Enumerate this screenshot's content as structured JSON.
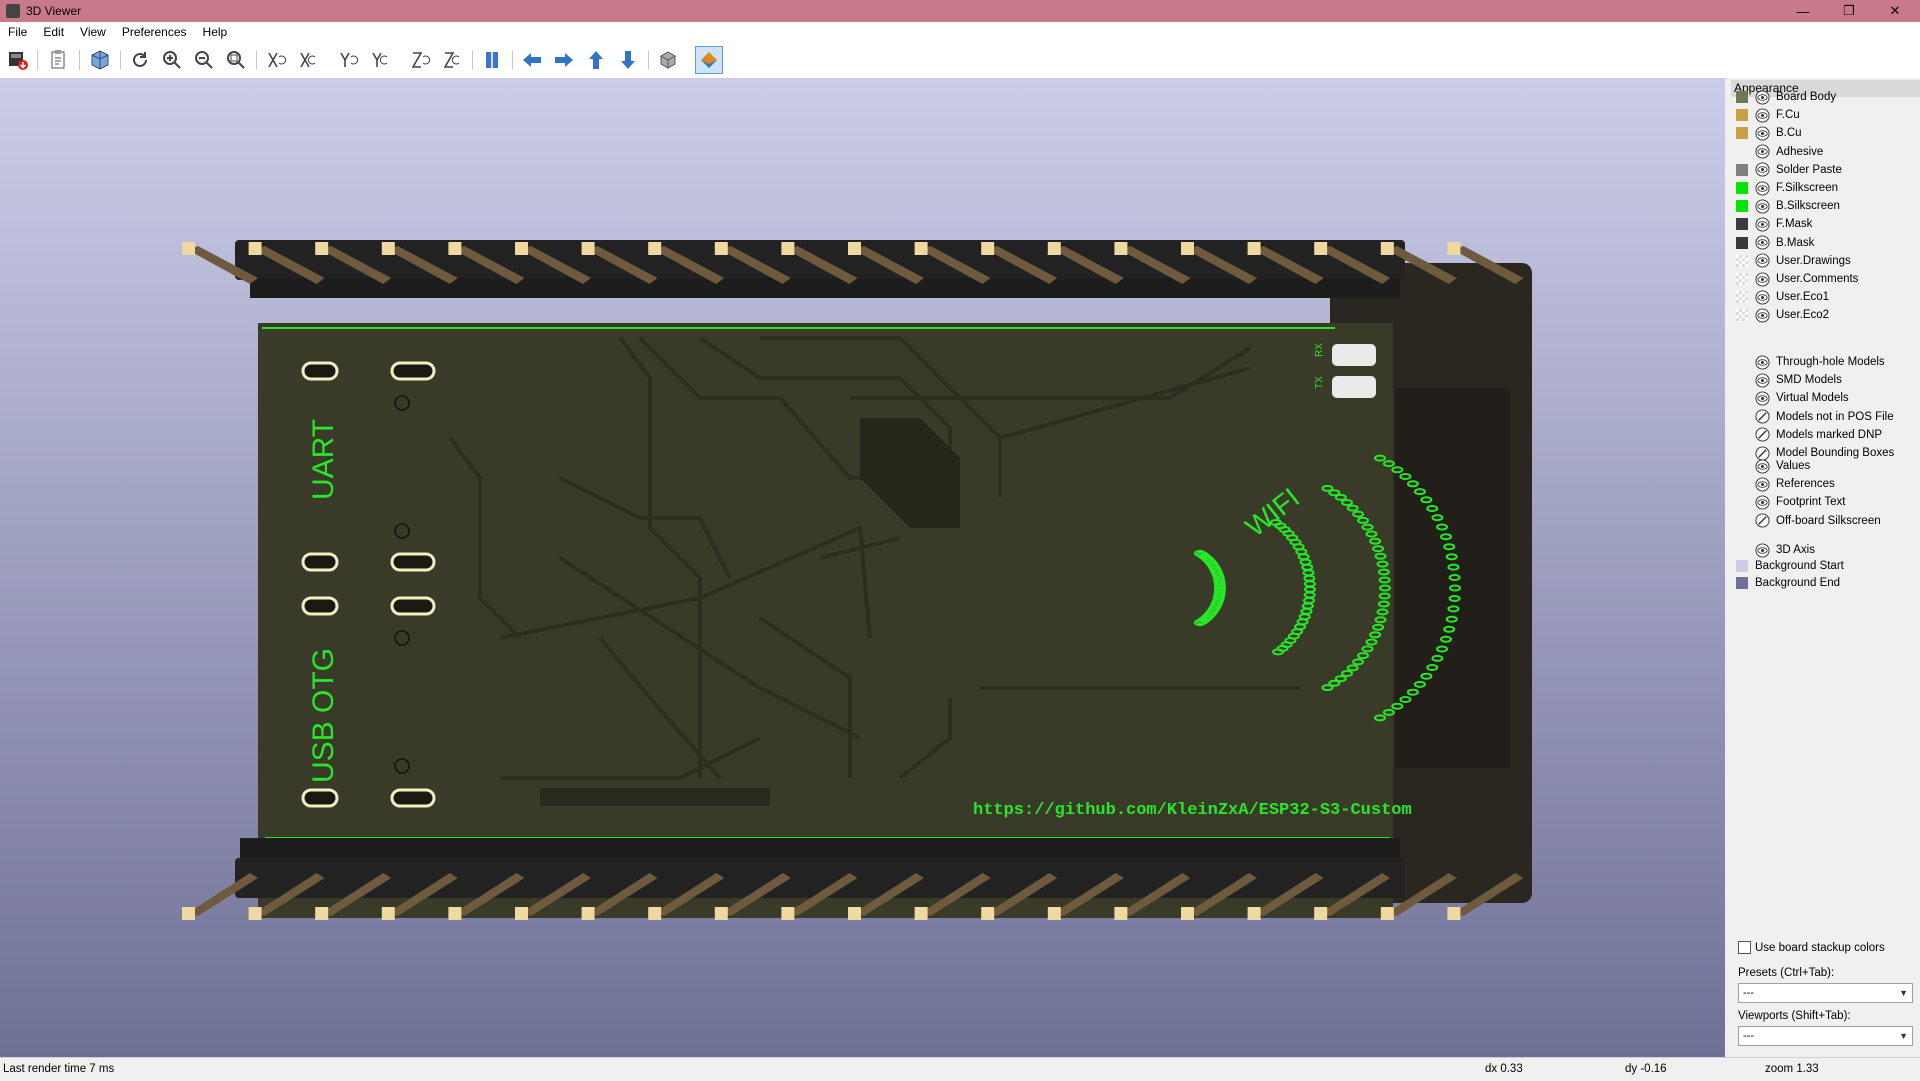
{
  "window": {
    "title": "3D Viewer",
    "controls": {
      "minimize": "—",
      "maximize": "❐",
      "close": "✕"
    }
  },
  "menu": [
    "File",
    "Edit",
    "View",
    "Preferences",
    "Help"
  ],
  "toolbar": {
    "icons": [
      "export-image-icon",
      "copy-clipboard-icon",
      "board-3d-icon",
      "reload-icon",
      "zoom-in-icon",
      "zoom-out-icon",
      "zoom-fit-icon",
      "rotate-x-cw-icon",
      "rotate-x-ccw-icon",
      "rotate-y-cw-icon",
      "rotate-y-ccw-icon",
      "rotate-z-cw-icon",
      "rotate-z-ccw-icon",
      "flip-board-icon",
      "move-left-icon",
      "move-right-icon",
      "move-up-icon",
      "move-down-icon",
      "orthographic-icon",
      "show-layers-icon"
    ]
  },
  "board": {
    "silk_uart": "UART",
    "silk_usb": "USB OTG",
    "silk_wifi": "WIFI",
    "silk_url": "https://github.com/KleinZxA/ESP32-S3-Custom",
    "silk_rx": "RX",
    "silk_tx": "TX"
  },
  "appearance": {
    "header": "Appearance",
    "layers": [
      {
        "label": "Board Body",
        "color": "#6b7a56",
        "eye": true
      },
      {
        "label": "F.Cu",
        "color": "#c8a040",
        "eye": true
      },
      {
        "label": "B.Cu",
        "color": "#c8a040",
        "eye": true
      },
      {
        "label": "Adhesive",
        "color": "",
        "eye": true
      },
      {
        "label": "Solder Paste",
        "color": "#808080",
        "eye": true
      },
      {
        "label": "F.Silkscreen",
        "color": "#00e600",
        "eye": true
      },
      {
        "label": "B.Silkscreen",
        "color": "#00e600",
        "eye": true
      },
      {
        "label": "F.Mask",
        "color": "#3a3a3a",
        "eye": true
      },
      {
        "label": "B.Mask",
        "color": "#3a3a3a",
        "eye": true
      },
      {
        "label": "User.Drawings",
        "color": "checker",
        "eye": true
      },
      {
        "label": "User.Comments",
        "color": "checker",
        "eye": true
      },
      {
        "label": "User.Eco1",
        "color": "checker",
        "eye": true
      },
      {
        "label": "User.Eco2",
        "color": "checker",
        "eye": true
      }
    ],
    "models": [
      {
        "label": "Through-hole Models",
        "eye": true
      },
      {
        "label": "SMD Models",
        "eye": true
      },
      {
        "label": "Virtual Models",
        "eye": true
      },
      {
        "label": "Models not in POS File",
        "eye": false
      },
      {
        "label": "Models marked DNP",
        "eye": false
      },
      {
        "label": "Model Bounding Boxes",
        "eye": false
      }
    ],
    "text": [
      {
        "label": "Values",
        "eye": true
      },
      {
        "label": "References",
        "eye": true
      },
      {
        "label": "Footprint Text",
        "eye": true
      },
      {
        "label": "Off-board Silkscreen",
        "eye": false
      }
    ],
    "misc": [
      {
        "label": "3D Axis",
        "eye": true,
        "color": ""
      },
      {
        "label": "Background Start",
        "eye": null,
        "color": "#cbcde8"
      },
      {
        "label": "Background End",
        "eye": null,
        "color": "#6f7096"
      }
    ],
    "use_stackup_label": "Use board stackup colors",
    "presets_label": "Presets (Ctrl+Tab):",
    "presets_value": "---",
    "viewports_label": "Viewports (Shift+Tab):",
    "viewports_value": "---"
  },
  "status": {
    "render_time": "Last render time 7 ms",
    "dx": "dx 0.33",
    "dy": "dy -0.16",
    "zoom": "zoom 1.33"
  }
}
